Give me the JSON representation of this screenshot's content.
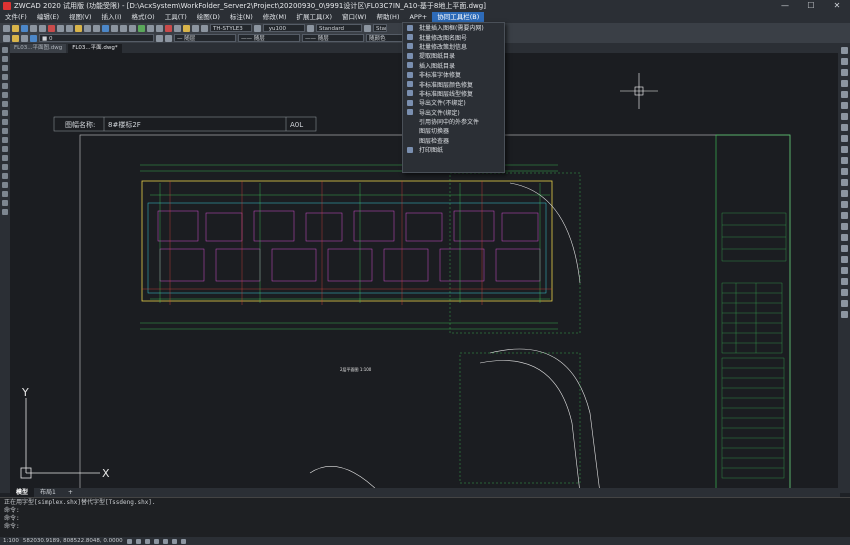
{
  "window": {
    "title": "ZWCAD 2020 试用版 (功能受限) - [D:\\AcxSystem\\WorkFolder_Server2\\Project\\20200930_0\\9991设计区\\FL03C7IN_A10-基于8地上平面.dwg]",
    "minimize": "—",
    "maximize": "☐",
    "close": "✕"
  },
  "menubar": {
    "items": [
      "文件(F)",
      "编辑(E)",
      "视图(V)",
      "插入(I)",
      "格式(O)",
      "工具(T)",
      "绘图(D)",
      "标注(N)",
      "修改(M)",
      "扩展工具(X)",
      "窗口(W)",
      "帮助(H)",
      "APP+",
      "协同工具栏(B)"
    ],
    "active_index": 13
  },
  "toolbar2": {
    "layer_combo": "■ 0",
    "color_combo": "— 随层",
    "linetype_combo": "—— 随层",
    "lineweight_combo": "—— 随层",
    "plotstyle_combo": "随颜色"
  },
  "toolbar1": {
    "textstyle_combo": "TH-STYLE3",
    "dimstyle_combo": "_yu100",
    "tablestyle_combo": "Standard",
    "extra_combo": "Stan"
  },
  "doc_tabs": [
    {
      "label": "FL03...平面图.dwg"
    },
    {
      "label": "FL03...平面.dwg*"
    }
  ],
  "layout_tabs": [
    "模型",
    "布局1",
    "+"
  ],
  "dropdown": {
    "items": [
      {
        "label": "批量插入图框(需要内网)",
        "icon": "frame-icon"
      },
      {
        "label": "批量修改图名图号",
        "icon": "edit-icon"
      },
      {
        "label": "批量修改策划信息",
        "icon": "edit-icon"
      },
      {
        "label": "提取图纸目录",
        "icon": "list-icon"
      },
      {
        "label": "插入图纸目录",
        "icon": "list-icon"
      },
      {
        "label": "非标准字体修复",
        "icon": "font-icon"
      },
      {
        "label": "非标准图层颜色修复",
        "icon": "palette-icon"
      },
      {
        "label": "非标准图层线型修复",
        "icon": "line-icon"
      },
      {
        "label": "导出文件(不绑定)",
        "icon": "export-icon"
      },
      {
        "label": "导出文件(绑定)",
        "icon": "export-icon"
      },
      {
        "label": "引用协同中的外参文件",
        "icon": "none"
      },
      {
        "label": "图层切换器",
        "icon": "none"
      },
      {
        "label": "图层检查器",
        "icon": "none"
      },
      {
        "label": "打印图纸",
        "icon": "print-icon"
      }
    ]
  },
  "drawing": {
    "header_label": "图幅名称:",
    "header_value": "8#楼标2F",
    "header_right": "A0L",
    "plan_title": "2层平面图  1:100",
    "ucs_x": "X",
    "ucs_y": "Y"
  },
  "command": {
    "lines": [
      "正在用字型[simplex.shx]替代字型[Tssdeng.shx].",
      "命令:",
      "命令:",
      "命令:"
    ]
  },
  "statusbar": {
    "scale": "1:100",
    "coords": "582030.9189, 808522.8048, 0.0000"
  },
  "colors": {
    "accent": "#2e6bb8",
    "cad_yellow": "#e5d04a",
    "cad_green": "#3fd05a",
    "cad_cyan": "#38c8d8",
    "cad_magenta": "#d04fd0",
    "cad_red": "#d9453a"
  }
}
